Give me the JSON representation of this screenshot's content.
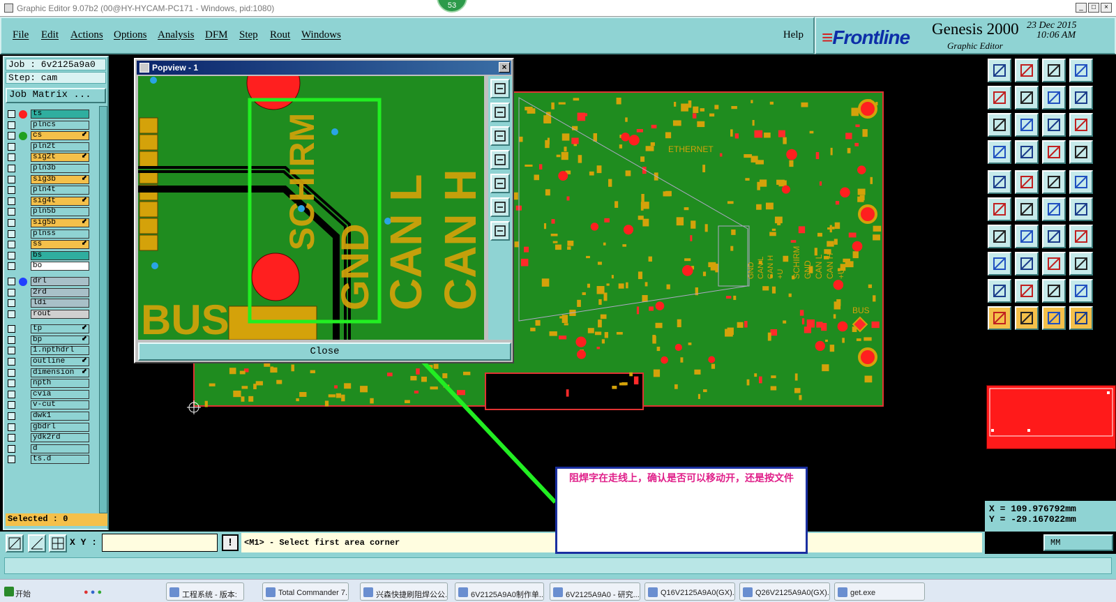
{
  "window": {
    "title": "Graphic Editor 9.07b2 (00@HY-HYCAM-PC171 - Windows, pid:1080)",
    "badge": "53",
    "controls": [
      "_",
      "□",
      "×"
    ]
  },
  "menu": {
    "items": [
      "File",
      "Edit",
      "Actions",
      "Options",
      "Analysis",
      "DFM",
      "Step",
      "Rout",
      "Windows"
    ],
    "help": "Help"
  },
  "brand": {
    "logo": "Frontline",
    "product": "Genesis 2000",
    "subtitle": "Graphic Editor",
    "date": "23 Dec 2015",
    "time": "10:06 AM"
  },
  "left_panel": {
    "job": "Job : 6v2125a9a0",
    "step": "Step: cam",
    "job_matrix": "Job Matrix ...",
    "selected": "Selected : 0",
    "layers": [
      {
        "name": "ts",
        "bg": "#2fae9f",
        "dot": "#ff2020",
        "arrow": ""
      },
      {
        "name": "plncs",
        "bg": "#8fd3d3",
        "dot": "",
        "arrow": ""
      },
      {
        "name": "cs",
        "bg": "#f4c04a",
        "dot": "#20a020",
        "arrow": "⬋"
      },
      {
        "name": "pln2t",
        "bg": "#8fd3d3",
        "dot": "",
        "arrow": ""
      },
      {
        "name": "sig2t",
        "bg": "#f4c04a",
        "dot": "",
        "arrow": "⬋"
      },
      {
        "name": "pln3b",
        "bg": "#8fd3d3",
        "dot": "",
        "arrow": ""
      },
      {
        "name": "sig3b",
        "bg": "#f4c04a",
        "dot": "",
        "arrow": "⬋"
      },
      {
        "name": "pln4t",
        "bg": "#8fd3d3",
        "dot": "",
        "arrow": ""
      },
      {
        "name": "sig4t",
        "bg": "#f4c04a",
        "dot": "",
        "arrow": "⬋"
      },
      {
        "name": "pln5b",
        "bg": "#8fd3d3",
        "dot": "",
        "arrow": ""
      },
      {
        "name": "sig5b",
        "bg": "#f4c04a",
        "dot": "",
        "arrow": "⬋"
      },
      {
        "name": "plnss",
        "bg": "#8fd3d3",
        "dot": "",
        "arrow": ""
      },
      {
        "name": "ss",
        "bg": "#f4c04a",
        "dot": "",
        "arrow": "⬋"
      },
      {
        "name": "bs",
        "bg": "#2fae9f",
        "dot": "",
        "arrow": ""
      },
      {
        "name": "bo",
        "bg": "#ffffff",
        "dot": "",
        "arrow": ""
      },
      {
        "name": "drl",
        "bg": "#a8c0c8",
        "dot": "#2040ff",
        "arrow": ""
      },
      {
        "name": "2rd",
        "bg": "#a8c0c8",
        "dot": "",
        "arrow": ""
      },
      {
        "name": "ldi",
        "bg": "#a8c0c8",
        "dot": "",
        "arrow": ""
      },
      {
        "name": "rout",
        "bg": "#d0d0d0",
        "dot": "",
        "arrow": ""
      },
      {
        "name": "tp",
        "bg": "#8fd3d3",
        "dot": "",
        "arrow": "⬋"
      },
      {
        "name": "bp",
        "bg": "#8fd3d3",
        "dot": "",
        "arrow": "⬋"
      },
      {
        "name": "1.npthdrl",
        "bg": "#8fd3d3",
        "dot": "",
        "arrow": ""
      },
      {
        "name": "outline",
        "bg": "#8fd3d3",
        "dot": "",
        "arrow": "⬋"
      },
      {
        "name": "dimension",
        "bg": "#8fd3d3",
        "dot": "",
        "arrow": "⬋"
      },
      {
        "name": "npth",
        "bg": "#8fd3d3",
        "dot": "",
        "arrow": ""
      },
      {
        "name": "cvia",
        "bg": "#8fd3d3",
        "dot": "",
        "arrow": ""
      },
      {
        "name": "v-cut",
        "bg": "#8fd3d3",
        "dot": "",
        "arrow": ""
      },
      {
        "name": "dwk1",
        "bg": "#8fd3d3",
        "dot": "",
        "arrow": ""
      },
      {
        "name": "gbdrl",
        "bg": "#8fd3d3",
        "dot": "",
        "arrow": ""
      },
      {
        "name": "ydk2rd",
        "bg": "#8fd3d3",
        "dot": "",
        "arrow": ""
      },
      {
        "name": "d",
        "bg": "#8fd3d3",
        "dot": "",
        "arrow": ""
      },
      {
        "name": "ts.d",
        "bg": "#8fd3d3",
        "dot": "",
        "arrow": ""
      }
    ]
  },
  "popview": {
    "title": "Popview - 1",
    "close_x": "×",
    "close_button": "Close",
    "silk_labels": [
      "SCHIRM",
      "GND",
      "CAN L",
      "CAN H",
      "BUS"
    ]
  },
  "board": {
    "labels": [
      "ETHERNET",
      "BUS",
      "SCHIRM",
      "GND",
      "CAN L",
      "CAN H",
      "+U"
    ]
  },
  "note": {
    "text": "阻焊字在走线上，确认是否可以移动开，还是按文件"
  },
  "coords": {
    "x": "X = 109.976792mm",
    "y": "Y = -29.167022mm"
  },
  "units": "MM",
  "command": {
    "xy_label": "X Y :",
    "xy_value": "",
    "warn": "!",
    "prompt": "<M1> - Select first area corner"
  },
  "taskbar": {
    "items": [
      "开始",
      "工程系统 - 版本:",
      "Total Commander 7...",
      "兴森快捷刷阻焊公公...",
      "6V2125A9A0制作单...",
      "6V2125A9A0 - 研究...",
      "Q16V2125A9A0(GX)...",
      "Q26V2125A9A0(GX)...",
      "get.exe"
    ]
  }
}
